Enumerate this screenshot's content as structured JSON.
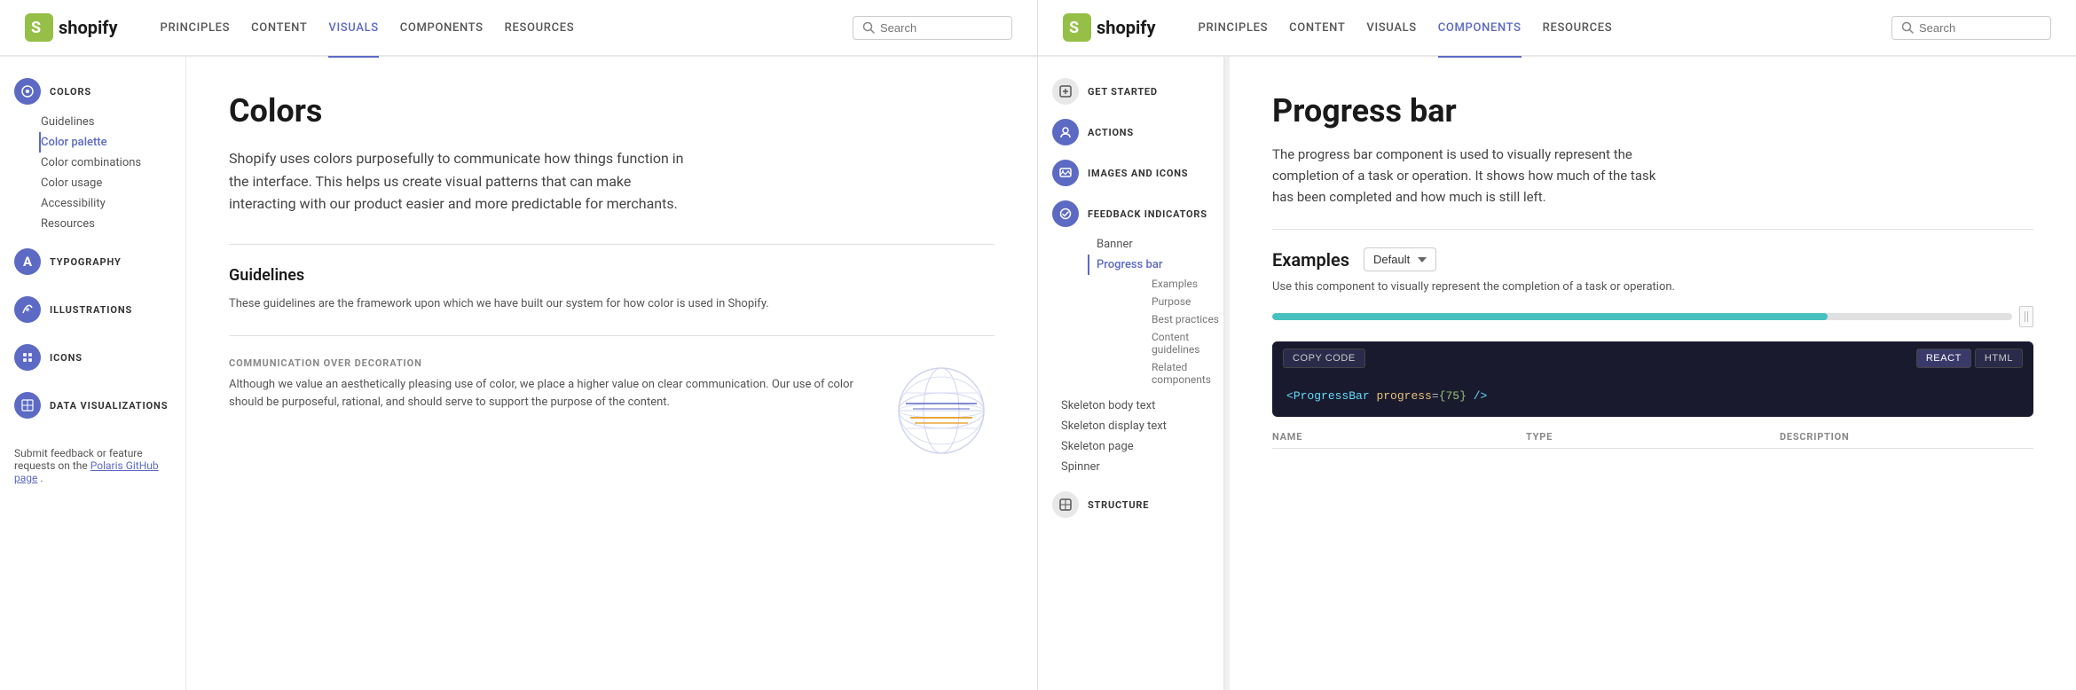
{
  "panel1": {
    "logo": "shopify",
    "nav": {
      "links": [
        "PRINCIPLES",
        "CONTENT",
        "VISUALS",
        "COMPONENTS",
        "RESOURCES"
      ],
      "active": "VISUALS"
    },
    "search": {
      "placeholder": "Search"
    },
    "sidebar": {
      "sections": [
        {
          "id": "colors",
          "icon": "🎨",
          "title": "COLORS",
          "active": true,
          "items": [
            "Guidelines",
            "Color palette",
            "Color combinations",
            "Color usage",
            "Accessibility",
            "Resources"
          ]
        },
        {
          "id": "typography",
          "icon": "A",
          "title": "TYPOGRAPHY",
          "active": false,
          "items": []
        },
        {
          "id": "illustrations",
          "icon": "✏️",
          "title": "ILLUSTRATIONS",
          "active": false,
          "items": []
        },
        {
          "id": "icons",
          "icon": "◈",
          "title": "ICONS",
          "active": false,
          "items": []
        },
        {
          "id": "data-viz",
          "icon": "▦",
          "title": "DATA VISUALIZATIONS",
          "active": false,
          "items": []
        }
      ],
      "footer": {
        "text": "Submit feedback or feature requests on the",
        "link_text": "Polaris GitHub page",
        "suffix": "."
      }
    },
    "main": {
      "title": "Colors",
      "intro": "Shopify uses colors purposefully to communicate how things function in the interface. This helps us create visual patterns that can make interacting with our product easier and more predictable for merchants.",
      "section1": {
        "title": "Guidelines",
        "body": "These guidelines are the framework upon which we have built our system for how color is used in Shopify."
      },
      "section2": {
        "label": "COMMUNICATION OVER DECORATION",
        "body": "Although we value an aesthetically pleasing use of color, we place a higher value on clear communication. Our use of color should be purposeful, rational, and should serve to support the purpose of the content."
      }
    }
  },
  "panel2": {
    "logo": "shopify",
    "nav": {
      "links": [
        "PRINCIPLES",
        "CONTENT",
        "VISUALS",
        "COMPONENTS",
        "RESOURCES"
      ],
      "active": "COMPONENTS"
    },
    "search": {
      "placeholder": "Search"
    },
    "sidebar": {
      "sections": [
        {
          "id": "get-started",
          "icon": "▣",
          "label": "GET STARTED",
          "items": [],
          "border_color": "#e0e0e0"
        },
        {
          "id": "actions",
          "icon": "👤",
          "label": "ACTIONS",
          "items": [],
          "border_color": "#5c6ac4"
        },
        {
          "id": "images-icons",
          "icon": "🖼",
          "label": "IMAGES AND ICONS",
          "items": [],
          "border_color": "#5c6ac4"
        },
        {
          "id": "feedback-indicators",
          "icon": "⚙",
          "label": "FEEDBACK INDICATORS",
          "items": [
            "Banner",
            "Progress bar",
            "Examples",
            "Purpose",
            "Best practices",
            "Content guidelines",
            "Related components"
          ],
          "active_item": "Progress bar",
          "border_color": "#5c6ac4"
        },
        {
          "id": "structure",
          "icon": "▣",
          "label": "STRUCTURE",
          "items": [
            "Skeleton body text",
            "Skeleton display text",
            "Skeleton page",
            "Spinner"
          ],
          "border_color": "#e0e0e0"
        }
      ]
    },
    "main": {
      "title": "Progress bar",
      "intro": "The progress bar component is used to visually represent the completion of a task or operation. It shows how much of the task has been completed and how much is still left.",
      "examples_label": "Examples",
      "examples_dropdown": "Default",
      "examples_desc": "Use this component to visually represent the completion of a task or operation.",
      "progress_value": 75,
      "code": {
        "copy_label": "COPY CODE",
        "tab_react": "REACT",
        "tab_html": "HTML",
        "active_tab": "REACT",
        "line": "<ProgressBar progress={75} />"
      },
      "props": {
        "columns": [
          "NAME",
          "TYPE",
          "DESCRIPTION"
        ]
      }
    }
  }
}
